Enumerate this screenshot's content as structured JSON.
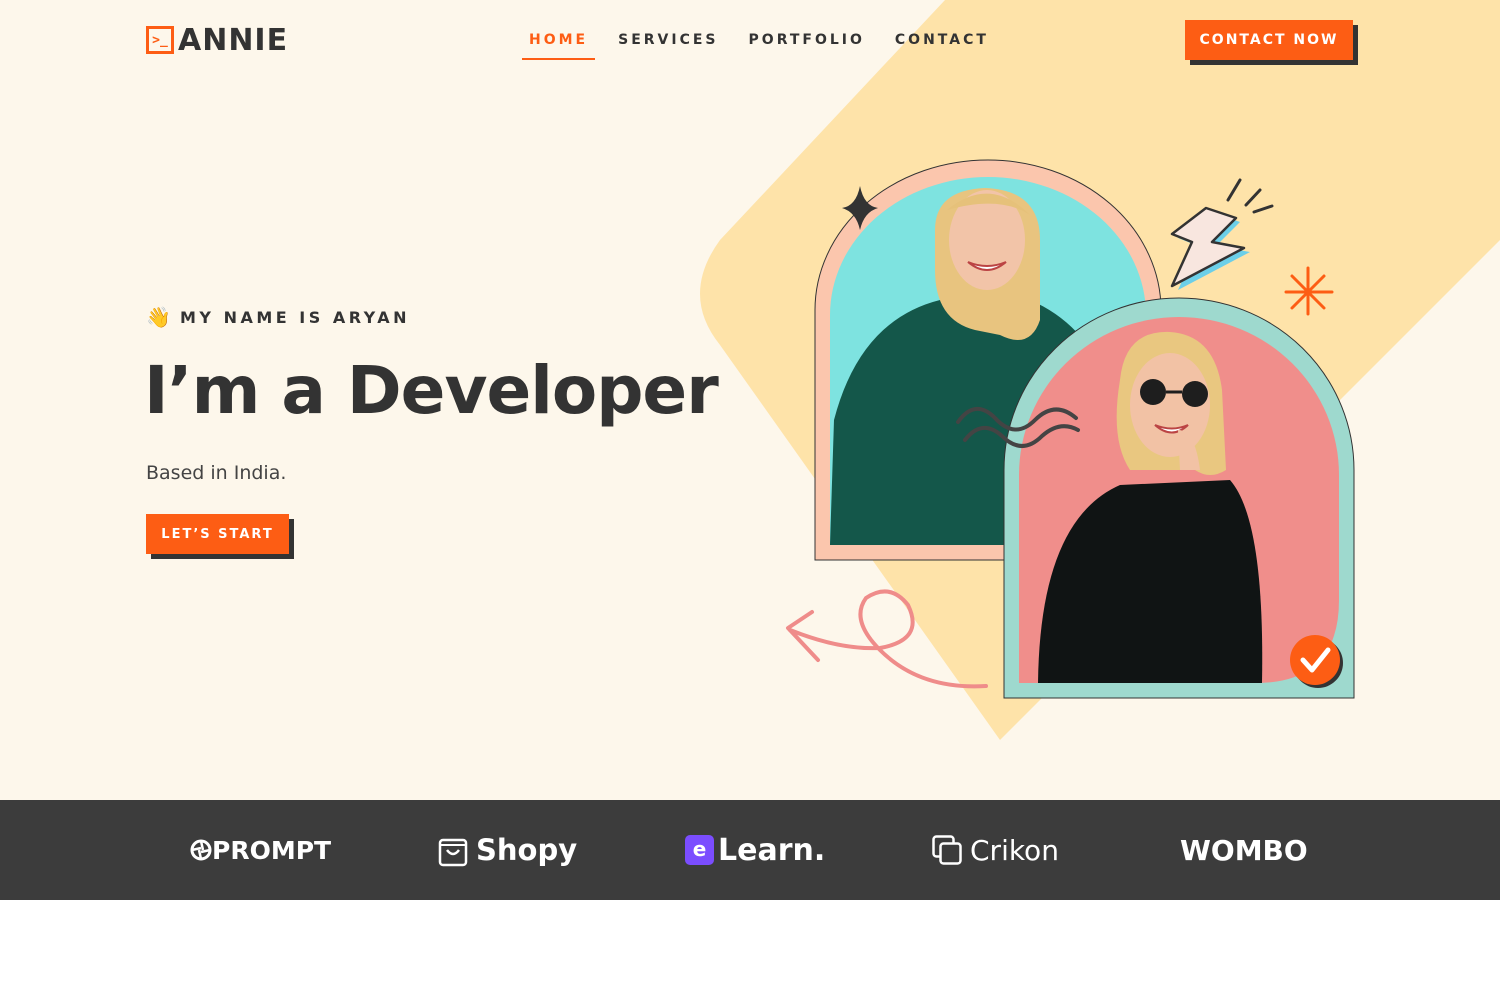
{
  "header": {
    "logo_mark": ">_",
    "logo_text": "ANNIE",
    "nav": [
      {
        "label": "HOME",
        "active": true
      },
      {
        "label": "SERVICES",
        "active": false
      },
      {
        "label": "PORTFOLIO",
        "active": false
      },
      {
        "label": "CONTACT",
        "active": false
      }
    ],
    "cta_label": "CONTACT NOW"
  },
  "hero": {
    "wave_emoji": "👋",
    "intro": "MY NAME IS ARYAN",
    "headline": "I’m a Developer",
    "subline": "Based in India.",
    "button_label": "LET’S START"
  },
  "brands": [
    {
      "name": "PROMPT",
      "icon": "aperture-icon"
    },
    {
      "name": "Shopy",
      "icon": "shopping-bag-icon"
    },
    {
      "name": "Learn.",
      "icon": "e-badge-icon",
      "icon_letter": "e"
    },
    {
      "name": "Crikon",
      "icon": "stacked-squares-icon"
    },
    {
      "name": "OMBO",
      "icon": "w-mark-icon",
      "icon_letter": "W"
    }
  ],
  "colors": {
    "accent": "#fd5d14",
    "dark": "#333333",
    "hero_bg": "#fdf7eb",
    "diamond": "#fee3a9",
    "brand_bar": "#3c3c3c",
    "learn_badge": "#7b4dff"
  }
}
